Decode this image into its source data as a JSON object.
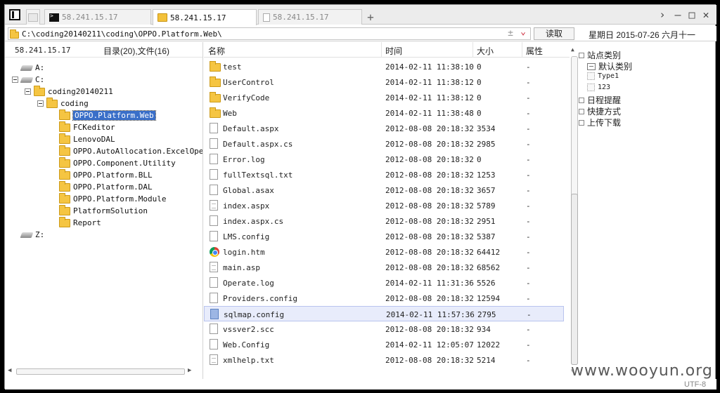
{
  "tabs": [
    {
      "label": "58.241.15.17",
      "icon": "terminal-icon",
      "active": false
    },
    {
      "label": "58.241.15.17",
      "icon": "folder-icon",
      "active": true
    },
    {
      "label": "58.241.15.17",
      "icon": "document-icon",
      "active": false
    }
  ],
  "address": {
    "path": "C:\\coding20140211\\coding\\OPPO.Platform.Web\\",
    "separator": "±",
    "read_button": "读取"
  },
  "date_text": "星期日 2015-07-26 六月十一",
  "left_panel": {
    "host": "58.241.15.17",
    "count": "目录(20),文件(16)"
  },
  "tree": [
    {
      "label": "A:",
      "type": "drive",
      "level": 0,
      "expander": "none"
    },
    {
      "label": "C:",
      "type": "drive",
      "level": 0,
      "expander": "minus"
    },
    {
      "label": "coding20140211",
      "type": "folder",
      "level": 1,
      "expander": "minus"
    },
    {
      "label": "coding",
      "type": "folder",
      "level": 2,
      "expander": "minus"
    },
    {
      "label": "OPPO.Platform.Web",
      "type": "folder",
      "level": 3,
      "expander": "plus",
      "selected": true
    },
    {
      "label": "FCKeditor",
      "type": "folder",
      "level": 3,
      "expander": "none"
    },
    {
      "label": "LenovoDAL",
      "type": "folder",
      "level": 3,
      "expander": "none"
    },
    {
      "label": "OPPO.AutoAllocation.ExcelOpera",
      "type": "folder",
      "level": 3,
      "expander": "none"
    },
    {
      "label": "OPPO.Component.Utility",
      "type": "folder",
      "level": 3,
      "expander": "none"
    },
    {
      "label": "OPPO.Platform.BLL",
      "type": "folder",
      "level": 3,
      "expander": "none"
    },
    {
      "label": "OPPO.Platform.DAL",
      "type": "folder",
      "level": 3,
      "expander": "none"
    },
    {
      "label": "OPPO.Platform.Module",
      "type": "folder",
      "level": 3,
      "expander": "plus"
    },
    {
      "label": "PlatformSolution",
      "type": "folder",
      "level": 3,
      "expander": "plus"
    },
    {
      "label": "Report",
      "type": "folder",
      "level": 3,
      "expander": "plus"
    },
    {
      "label": "Z:",
      "type": "drive",
      "level": 0,
      "expander": "none"
    }
  ],
  "columns": {
    "name": "名称",
    "time": "时间",
    "size": "大小",
    "attr": "属性"
  },
  "files": [
    {
      "name": "test",
      "time": "2014-02-11 11:38:10",
      "size": "0",
      "attr": "-",
      "icon": "folder"
    },
    {
      "name": "UserControl",
      "time": "2014-02-11 11:38:12",
      "size": "0",
      "attr": "-",
      "icon": "folder"
    },
    {
      "name": "VerifyCode",
      "time": "2014-02-11 11:38:12",
      "size": "0",
      "attr": "-",
      "icon": "folder"
    },
    {
      "name": "Web",
      "time": "2014-02-11 11:38:48",
      "size": "0",
      "attr": "-",
      "icon": "folder"
    },
    {
      "name": "Default.aspx",
      "time": "2012-08-08 20:18:32",
      "size": "3534",
      "attr": "-",
      "icon": "doc"
    },
    {
      "name": "Default.aspx.cs",
      "time": "2012-08-08 20:18:32",
      "size": "2985",
      "attr": "-",
      "icon": "doc"
    },
    {
      "name": "Error.log",
      "time": "2012-08-08 20:18:32",
      "size": "0",
      "attr": "-",
      "icon": "doc"
    },
    {
      "name": "fullTextsql.txt",
      "time": "2012-08-08 20:18:32",
      "size": "1253",
      "attr": "-",
      "icon": "doc"
    },
    {
      "name": "Global.asax",
      "time": "2012-08-08 20:18:32",
      "size": "3657",
      "attr": "-",
      "icon": "doc"
    },
    {
      "name": "index.aspx",
      "time": "2012-08-08 20:18:32",
      "size": "5789",
      "attr": "-",
      "icon": "cfg"
    },
    {
      "name": "index.aspx.cs",
      "time": "2012-08-08 20:18:32",
      "size": "2951",
      "attr": "-",
      "icon": "doc"
    },
    {
      "name": "LMS.config",
      "time": "2012-08-08 20:18:32",
      "size": "5387",
      "attr": "-",
      "icon": "doc"
    },
    {
      "name": "login.htm",
      "time": "2012-08-08 20:18:32",
      "size": "64412",
      "attr": "-",
      "icon": "chrome"
    },
    {
      "name": "main.asp",
      "time": "2012-08-08 20:18:32",
      "size": "68562",
      "attr": "-",
      "icon": "cfg"
    },
    {
      "name": "Operate.log",
      "time": "2014-02-11 11:31:36",
      "size": "5526",
      "attr": "-",
      "icon": "doc"
    },
    {
      "name": "Providers.config",
      "time": "2012-08-08 20:18:32",
      "size": "12594",
      "attr": "-",
      "icon": "doc"
    },
    {
      "name": "sqlmap.config",
      "time": "2014-02-11 11:57:36",
      "size": "2795",
      "attr": "-",
      "icon": "sel",
      "highlight": true
    },
    {
      "name": "vssver2.scc",
      "time": "2012-08-08 20:18:32",
      "size": "934",
      "attr": "-",
      "icon": "doc"
    },
    {
      "name": "Web.Config",
      "time": "2014-02-11 12:05:07",
      "size": "12022",
      "attr": "-",
      "icon": "doc"
    },
    {
      "name": "xmlhelp.txt",
      "time": "2012-08-08 20:18:32",
      "size": "5214",
      "attr": "-",
      "icon": "cfg"
    }
  ],
  "right_panel": {
    "site_category": "站点类别",
    "default_category": "默认类别",
    "type1": "Type1",
    "type2": "123",
    "schedule": "日程提醒",
    "shortcuts": "快捷方式",
    "upload_download": "上传下载"
  },
  "status": {
    "encoding": "UTF-8"
  },
  "watermark": "www.wooyun.org"
}
